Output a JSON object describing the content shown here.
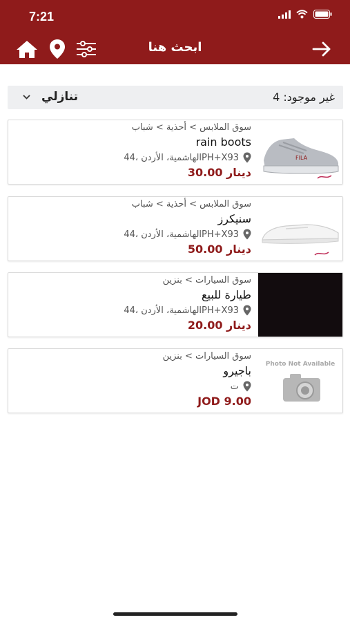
{
  "status": {
    "time": "7:21"
  },
  "header": {
    "title": "ابحث هنا"
  },
  "sort": {
    "results_label": "غير موجود: 4",
    "order_label": "تنازلي"
  },
  "listings": [
    {
      "category": "سوق الملابس > أحذية > شباب",
      "title": "rain boots",
      "location": "الهاشمية، الأردن ،44PH+X93",
      "price": "دينار 30.00",
      "image": "gray-sneaker"
    },
    {
      "category": "سوق الملابس > أحذية > شباب",
      "title": "سنيكرز",
      "location": "الهاشمية، الأردن ،44PH+X93",
      "price": "دينار 50.00",
      "image": "white-sneaker"
    },
    {
      "category": "سوق السيارات > بنزين",
      "title": "طيارة للبيع",
      "location": "الهاشمية، الأردن ،44PH+X93",
      "price": "دينار 20.00",
      "image": "dark-photo"
    },
    {
      "category": "سوق السيارات > بنزين",
      "title": "باجيرو",
      "location": "ت",
      "price": "JOD 9.00",
      "image": "photo-not-available",
      "image_text": "Photo Not Available"
    }
  ],
  "colors": {
    "brand": "#8f1b1b",
    "sortbar": "#eeeff1"
  }
}
